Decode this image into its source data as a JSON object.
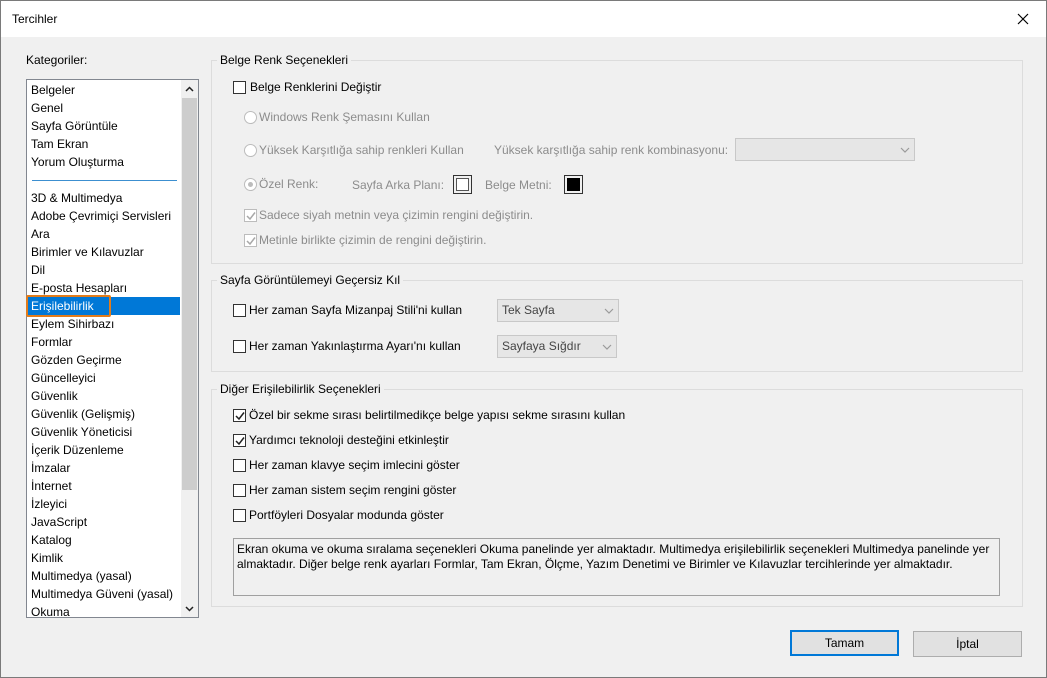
{
  "window": {
    "title": "Tercihler",
    "close_icon": "close-icon"
  },
  "categories": {
    "label": "Kategoriler:",
    "top_items": [
      "Belgeler",
      "Genel",
      "Sayfa Görüntüle",
      "Tam Ekran",
      "Yorum Oluşturma"
    ],
    "items": [
      "3D & Multimedya",
      "Adobe Çevrimiçi Servisleri",
      "Ara",
      "Birimler ve Kılavuzlar",
      "Dil",
      "E-posta Hesapları",
      "Erişilebilirlik",
      "Eylem Sihirbazı",
      "Formlar",
      "Gözden Geçirme",
      "Güncelleyici",
      "Güvenlik",
      "Güvenlik (Gelişmiş)",
      "Güvenlik Yöneticisi",
      "İçerik Düzenleme",
      "İmzalar",
      "İnternet",
      "İzleyici",
      "JavaScript",
      "Katalog",
      "Kimlik",
      "Multimedya (yasal)",
      "Multimedya Güveni (yasal)",
      "Okuma"
    ],
    "selected": "Erişilebilirlik"
  },
  "doc_color": {
    "title": "Belge Renk Seçenekleri",
    "replace_colors": "Belge Renklerini Değiştir",
    "replace_colors_checked": false,
    "windows_scheme": "Windows Renk Şemasını Kullan",
    "high_contrast": "Yüksek Karşıtlığa sahip renkleri Kullan",
    "high_contrast_combo_label": "Yüksek karşıtlığa sahip renk kombinasyonu:",
    "high_contrast_combo_value": "",
    "custom_color": "Özel Renk:",
    "page_bg_label": "Sayfa Arka Planı:",
    "page_bg_color": "#ffffff",
    "doc_text_label": "Belge Metni:",
    "doc_text_color": "#000000",
    "black_text_only": "Sadece siyah metnin veya çizimin rengini değiştirin.",
    "black_text_only_checked": true,
    "line_art": "Metinle birlikte çizimin de rengini değiştirin.",
    "line_art_checked": true
  },
  "page_display": {
    "title": "Sayfa Görüntülemeyi Geçersiz Kıl",
    "layout_label": "Her zaman Sayfa Mizanpaj Stili'ni kullan",
    "layout_checked": false,
    "layout_value": "Tek Sayfa",
    "zoom_label": "Her zaman Yakınlaştırma Ayarı'nı kullan",
    "zoom_checked": false,
    "zoom_value": "Sayfaya Sığdır"
  },
  "other": {
    "title": "Diğer Erişilebilirlik Seçenekleri",
    "options": [
      {
        "label": "Özel bir sekme sırası belirtilmedikçe belge yapısı sekme sırasını kullan",
        "checked": true
      },
      {
        "label": "Yardımcı teknoloji desteğini etkinleştir",
        "checked": true
      },
      {
        "label": "Her zaman klavye seçim imlecini göster",
        "checked": false
      },
      {
        "label": "Her zaman sistem seçim rengini göster",
        "checked": false
      },
      {
        "label": "Portföyleri Dosyalar modunda göster",
        "checked": false
      }
    ],
    "info": "Ekran okuma ve okuma sıralama seçenekleri Okuma panelinde yer almaktadır. Multimedya erişilebilirlik seçenekleri Multimedya panelinde yer almaktadır. Diğer belge renk ayarları Formlar, Tam Ekran, Ölçme, Yazım Denetimi ve Birimler ve Kılavuzlar tercihlerinde yer almaktadır."
  },
  "buttons": {
    "ok": "Tamam",
    "cancel": "İptal"
  },
  "colors": {
    "accent": "#0078d7",
    "focus": "#e27c1b",
    "selection": "#0078d7"
  }
}
